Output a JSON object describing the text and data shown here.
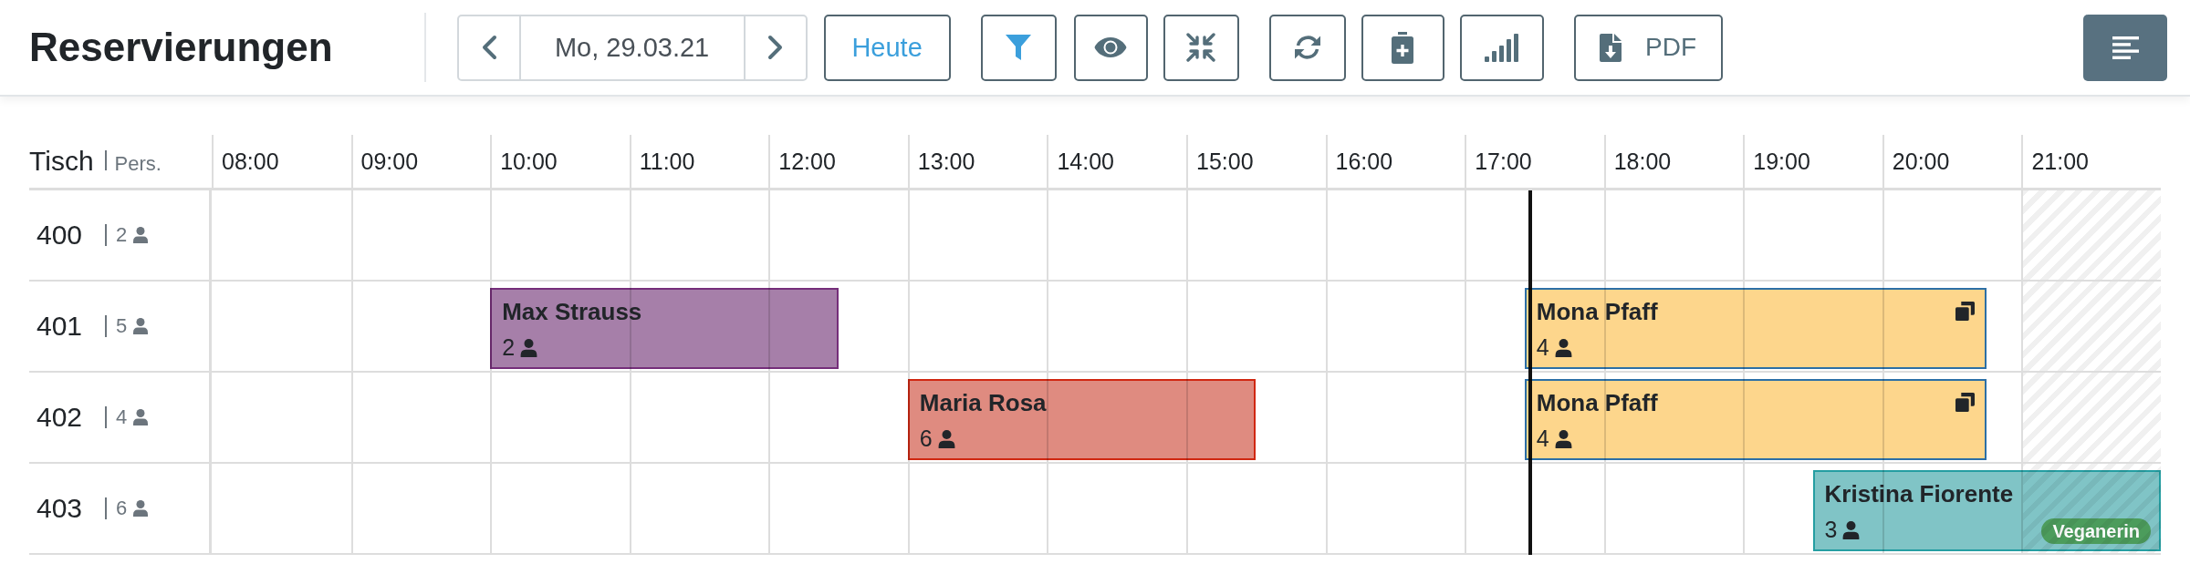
{
  "header": {
    "title": "Reservierungen",
    "date": "Mo, 29.03.21",
    "today_button": "Heute",
    "filter_active": true,
    "pdf_button": "PDF"
  },
  "schedule": {
    "table_heading": "Tisch",
    "seats_heading": "Pers.",
    "hours": [
      {
        "label": "08:00",
        "closed": false
      },
      {
        "label": "09:00",
        "closed": false
      },
      {
        "label": "10:00",
        "closed": false
      },
      {
        "label": "11:00",
        "closed": false
      },
      {
        "label": "12:00",
        "closed": false
      },
      {
        "label": "13:00",
        "closed": false
      },
      {
        "label": "14:00",
        "closed": false
      },
      {
        "label": "15:00",
        "closed": false
      },
      {
        "label": "16:00",
        "closed": false
      },
      {
        "label": "17:00",
        "closed": false
      },
      {
        "label": "18:00",
        "closed": false
      },
      {
        "label": "19:00",
        "closed": false
      },
      {
        "label": "20:00",
        "closed": false
      },
      {
        "label": "21:00",
        "closed": true
      }
    ],
    "rows": [
      {
        "table": "400",
        "seats": "2"
      },
      {
        "table": "401",
        "seats": "5",
        "reservations": [
          {
            "name": "Max Strauss",
            "guests": "2",
            "color": "#a67fa9",
            "linked": false
          },
          {
            "name": "Mona Pfaff",
            "guests": "4",
            "color": "#fdd68c",
            "linked": true
          }
        ]
      },
      {
        "table": "402",
        "seats": "4",
        "reservations": [
          {
            "name": "Maria Rosa",
            "guests": "6",
            "color": "#df8b80",
            "linked": false
          },
          {
            "name": "Mona Pfaff",
            "guests": "4",
            "color": "#fdd68c",
            "linked": true
          }
        ]
      },
      {
        "table": "403",
        "seats": "6",
        "reservations": [
          {
            "name": "Kristina Fiorente",
            "guests": "3",
            "color": "#80c4c6",
            "linked": false,
            "tag": "Veganerin"
          }
        ]
      }
    ]
  }
}
